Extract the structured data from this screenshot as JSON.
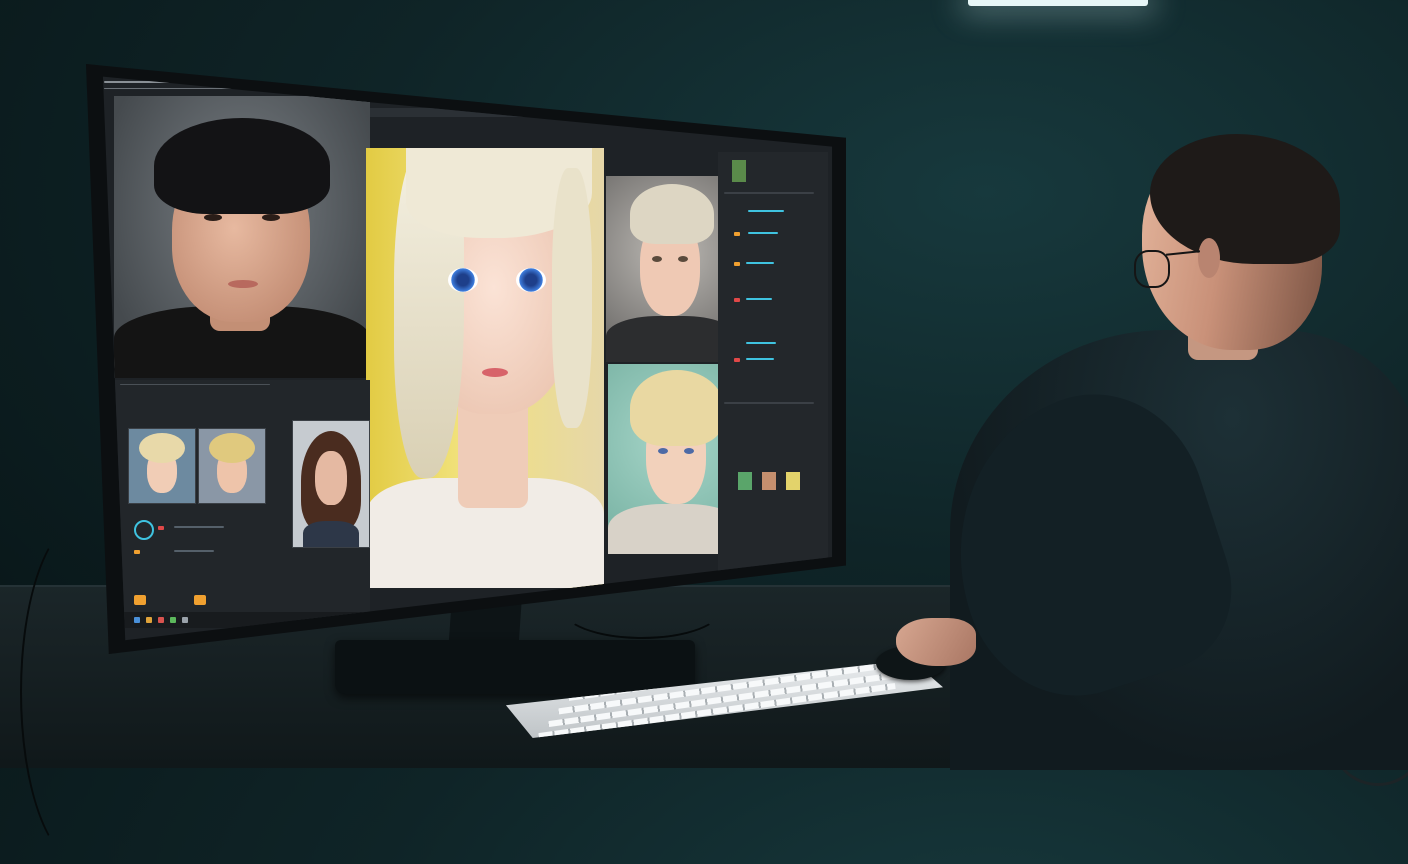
{
  "scene": {
    "description_colors": {
      "background": "#0f2427",
      "light": "#e7f6f7",
      "screen_bg": "#1e2226",
      "accent_cyan": "#3fc3e0",
      "accent_orange": "#f0a030",
      "accent_red": "#e04848"
    }
  },
  "editor": {
    "window_title": "",
    "menu_items": [
      "",
      "",
      "",
      "",
      "",
      ""
    ],
    "panel_titles": [
      "",
      ""
    ],
    "taskbar_icons": [
      "app-icon",
      "folder-icon",
      "browser-icon",
      "editor-icon",
      "settings-icon"
    ]
  },
  "photos": [
    {
      "name": "dark-haired-man-photo",
      "hair": "#141416",
      "skin": "#d9a88e",
      "bg": "#5c6266"
    },
    {
      "name": "blonde-anime-girl-closeup",
      "hair": "#eee9d6",
      "skin": "#f3d4c2",
      "bg": "#e8d24a",
      "eye": "#2c6ed1"
    },
    {
      "name": "blonde-anime-boy-portrait",
      "hair": "#d9d1bd",
      "skin": "#efc9b4",
      "bg": "#8a8886",
      "eye": "#5a4a3c"
    },
    {
      "name": "blonde-anime-teen-portrait",
      "hair": "#e7d59e",
      "skin": "#f2d1bb",
      "bg": "#8fc6b8",
      "eye": "#4d6aa6"
    },
    {
      "name": "brunette-woman-photo",
      "hair": "#4a2c1f",
      "skin": "#e5b9a2",
      "bg": "#c6cbd0"
    }
  ],
  "thumbnails": [
    {
      "name": "blonde-girl-thumb-1",
      "hair": "#e8d9a9",
      "skin": "#f1cdb6",
      "bg": "#6d8aa0"
    },
    {
      "name": "blonde-girl-thumb-2",
      "hair": "#e0c97e",
      "skin": "#eec4aa",
      "bg": "#8a97a6"
    }
  ],
  "small_previews": [
    {
      "color": "#5aa56a"
    },
    {
      "color": "#c58f6e"
    },
    {
      "color": "#e3d36b"
    }
  ]
}
